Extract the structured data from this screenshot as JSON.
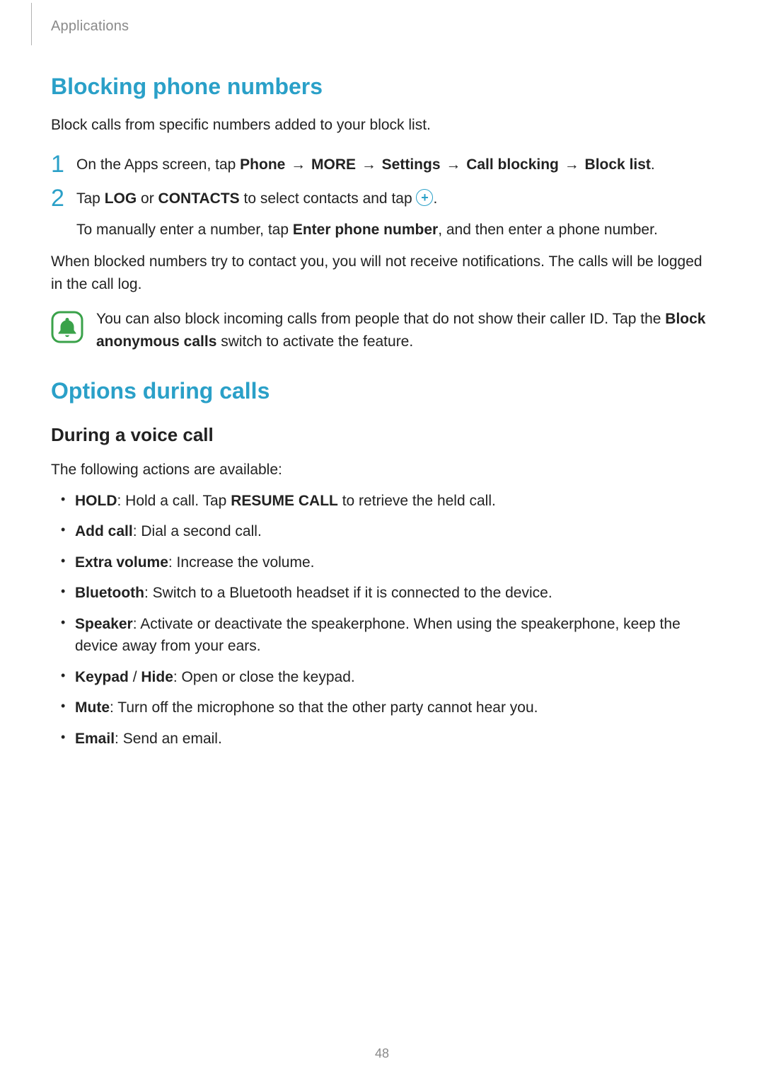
{
  "header": {
    "breadcrumb": "Applications"
  },
  "section1": {
    "title": "Blocking phone numbers",
    "intro": "Block calls from specific numbers added to your block list.",
    "step1": {
      "pre": "On the Apps screen, tap ",
      "b1": "Phone",
      "a1": " → ",
      "b2": "MORE",
      "a2": " → ",
      "b3": "Settings",
      "a3": " → ",
      "b4": "Call blocking",
      "a4": " → ",
      "b5": "Block list",
      "post": "."
    },
    "step2a": {
      "pre": "Tap ",
      "b1": "LOG",
      "mid1": " or ",
      "b2": "CONTACTS",
      "mid2": " to select contacts and tap ",
      "post": "."
    },
    "step2b": {
      "pre": "To manually enter a number, tap ",
      "b1": "Enter phone number",
      "post": ", and then enter a phone number."
    },
    "after": "When blocked numbers try to contact you, you will not receive notifications. The calls will be logged in the call log.",
    "note": {
      "pre": "You can also block incoming calls from people that do not show their caller ID. Tap the ",
      "b1": "Block anonymous calls",
      "post": " switch to activate the feature."
    }
  },
  "section2": {
    "title": "Options during calls",
    "subhead": "During a voice call",
    "intro": "The following actions are available:",
    "items": [
      {
        "b": "HOLD",
        "t": ": Hold a call. Tap ",
        "b2": "RESUME CALL",
        "t2": " to retrieve the held call."
      },
      {
        "b": "Add call",
        "t": ": Dial a second call."
      },
      {
        "b": "Extra volume",
        "t": ": Increase the volume."
      },
      {
        "b": "Bluetooth",
        "t": ": Switch to a Bluetooth headset if it is connected to the device."
      },
      {
        "b": "Speaker",
        "t": ": Activate or deactivate the speakerphone. When using the speakerphone, keep the device away from your ears."
      },
      {
        "b": "Keypad",
        "sep": " / ",
        "b2": "Hide",
        "t": ": Open or close the keypad."
      },
      {
        "b": "Mute",
        "t": ": Turn off the microphone so that the other party cannot hear you."
      },
      {
        "b": "Email",
        "t": ": Send an email."
      }
    ]
  },
  "pageNumber": "48",
  "nums": {
    "one": "1",
    "two": "2"
  }
}
